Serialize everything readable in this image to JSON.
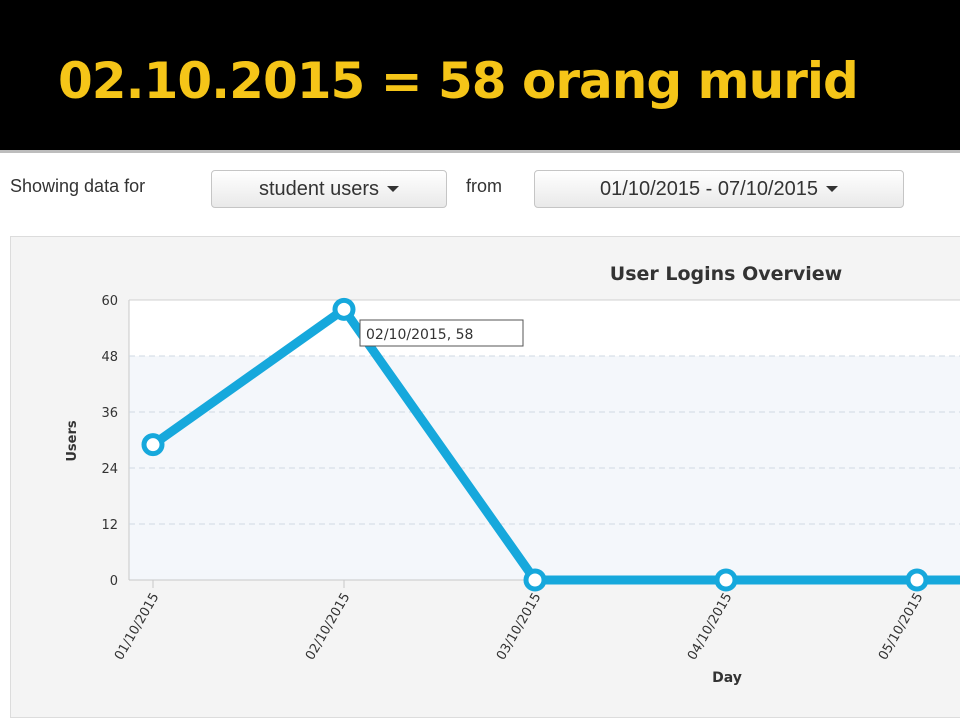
{
  "slide": {
    "title": "02.10.2015 = 58 orang murid"
  },
  "filters": {
    "showing_label": "Showing data for",
    "user_type": "student users",
    "from_label": "from",
    "date_range": "01/10/2015 - 07/10/2015"
  },
  "colors": {
    "title": "#f5c518",
    "line": "#16a8dc",
    "header_bg": "#000000"
  },
  "tooltip": {
    "text": "02/10/2015, 58"
  },
  "chart_data": {
    "type": "line",
    "title": "User Logins Overview",
    "xlabel": "Day",
    "ylabel": "Users",
    "categories": [
      "01/10/2015",
      "02/10/2015",
      "03/10/2015",
      "04/10/2015",
      "05/10/2015"
    ],
    "series": [
      {
        "values": [
          29,
          58,
          0,
          0,
          0
        ]
      }
    ],
    "continues_beyond_view": true,
    "ylim": [
      0,
      60
    ],
    "yticks": [
      0,
      12,
      24,
      36,
      48,
      60
    ],
    "grid": true
  }
}
